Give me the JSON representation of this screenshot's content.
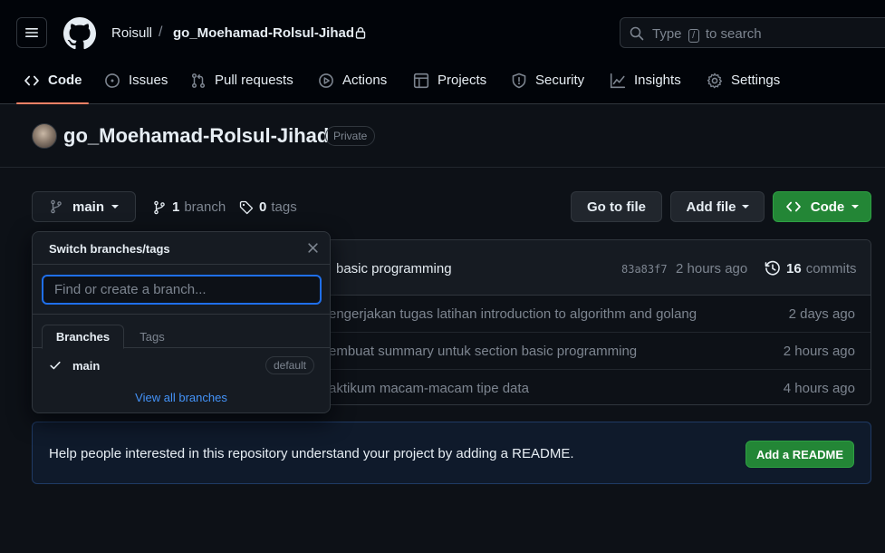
{
  "header": {
    "owner": "Roisull",
    "separator": "/",
    "repo": "go_Moehamad-Rolsul-Jihad",
    "search_before": "Type",
    "search_key": "/",
    "search_after": "to search"
  },
  "tabs": [
    {
      "label": "Code",
      "icon": "code-icon",
      "active": true
    },
    {
      "label": "Issues",
      "icon": "issue-opened-icon"
    },
    {
      "label": "Pull requests",
      "icon": "git-pull-request-icon"
    },
    {
      "label": "Actions",
      "icon": "play-icon"
    },
    {
      "label": "Projects",
      "icon": "table-icon"
    },
    {
      "label": "Security",
      "icon": "shield-icon"
    },
    {
      "label": "Insights",
      "icon": "graph-icon"
    },
    {
      "label": "Settings",
      "icon": "gear-icon"
    }
  ],
  "repo": {
    "title": "go_Moehamad-Rolsul-Jihad",
    "visibility": "Private"
  },
  "branch_bar": {
    "current_branch": "main",
    "branch_count": "1",
    "branch_word": "branch",
    "tag_count": "0",
    "tag_word": "tags",
    "go_to_file": "Go to file",
    "add_file": "Add file",
    "code": "Code"
  },
  "latest_commit": {
    "message": "basic programming",
    "hash": "83a83f7",
    "time": "2 hours ago",
    "commit_count": "16",
    "commit_word": "commits"
  },
  "files": [
    {
      "message": "engerjakan tugas latihan introduction to algorithm and golang",
      "time": "2 days ago"
    },
    {
      "message": "embuat summary untuk section basic programming",
      "time": "2 hours ago"
    },
    {
      "message": "aktikum macam-macam tipe data",
      "time": "4 hours ago"
    }
  ],
  "readme": {
    "text": "Help people interested in this repository understand your project by adding a README.",
    "button": "Add a README"
  },
  "dropdown": {
    "title": "Switch branches/tags",
    "placeholder": "Find or create a branch...",
    "tab_branches": "Branches",
    "tab_tags": "Tags",
    "item": "main",
    "item_badge": "default",
    "footer": "View all branches"
  },
  "colors": {
    "background": "#0d1117",
    "header": "#010409",
    "accent_tab": "#f78166",
    "primary_green": "#238636",
    "link_blue": "#4493f8",
    "focus_blue": "#1f6feb"
  }
}
